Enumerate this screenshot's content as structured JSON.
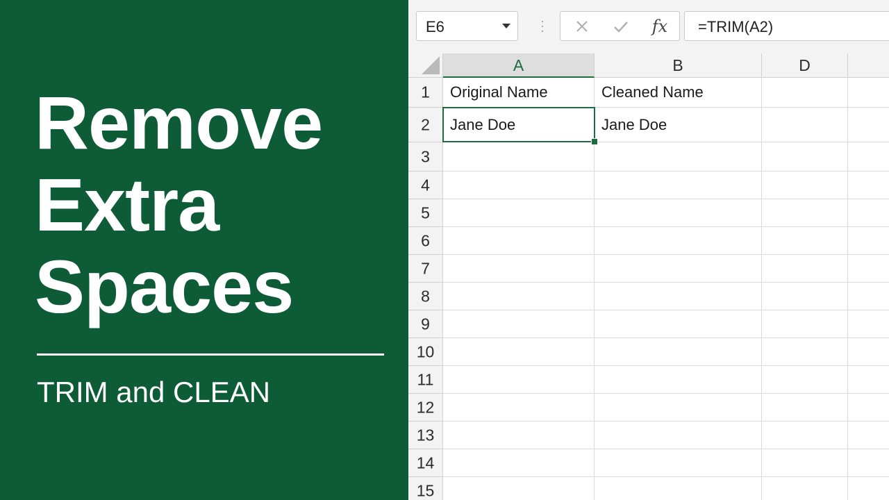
{
  "hero": {
    "title_lines": [
      "Remove",
      "Extra",
      "Spaces"
    ],
    "subtitle": "TRIM and CLEAN"
  },
  "toolbar": {
    "name_box": "E6",
    "cancel_icon": "close-icon",
    "enter_icon": "check-icon",
    "fx_label": "fx",
    "formula": "=TRIM(A2)"
  },
  "grid": {
    "columns": [
      "A",
      "B",
      "D"
    ],
    "active_column": "A",
    "rows": [
      "1",
      "2",
      "3",
      "4",
      "5",
      "6",
      "7",
      "8",
      "9",
      "10",
      "11",
      "12",
      "13",
      "14",
      "15"
    ],
    "cells": {
      "A1": "Original Name",
      "B1": "Cleaned Name",
      "A2": "Jane Doe",
      "B2": "Jane Doe"
    }
  },
  "colors": {
    "brand_green": "#0e5c37",
    "accent_green": "#1d6b40"
  }
}
